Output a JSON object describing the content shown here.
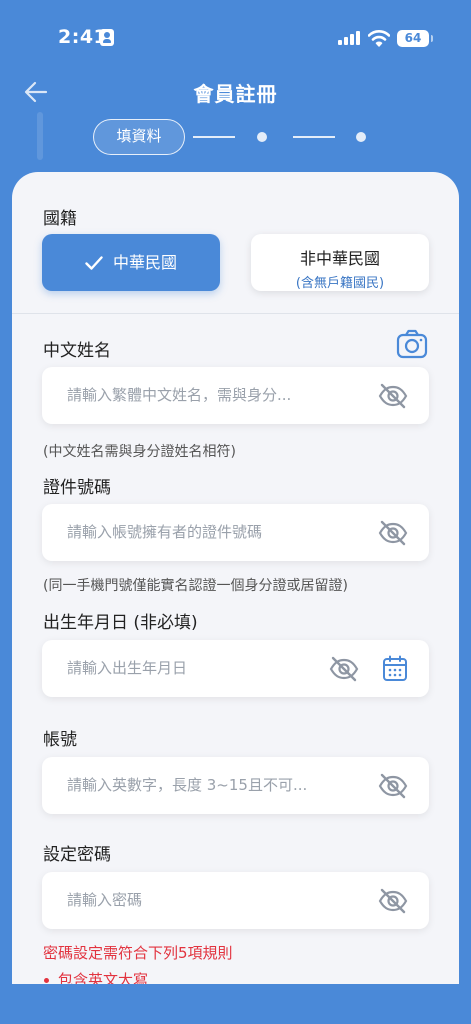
{
  "status_bar": {
    "time": "2:41",
    "battery": "64",
    "icons": [
      "contact-card-icon",
      "signal-icon",
      "wifi-icon",
      "battery-icon"
    ]
  },
  "header": {
    "title": "會員註冊",
    "back_icon": "arrow-left-icon"
  },
  "stepper": {
    "current_step_label": "填資料",
    "total_steps": 3,
    "current_step": 1
  },
  "nationality": {
    "label": "國籍",
    "options": [
      {
        "label": "中華民國",
        "selected": true
      },
      {
        "label": "非中華民國",
        "sublabel": "(含無戶籍國民)",
        "selected": false
      }
    ]
  },
  "chinese_name": {
    "label": "中文姓名",
    "placeholder": "請輸入繁體中文姓名，需與身分...",
    "hint": "(中文姓名需與身分證姓名相符)",
    "camera_icon": "camera-icon"
  },
  "id_number": {
    "label": "證件號碼",
    "placeholder": "請輸入帳號擁有者的證件號碼",
    "hint": "(同一手機門號僅能實名認證一個身分證或居留證)"
  },
  "birthday": {
    "label": "出生年月日 (非必填)",
    "placeholder": "請輸入出生年月日",
    "calendar_icon": "calendar-icon"
  },
  "account": {
    "label": "帳號",
    "placeholder": "請輸入英數字，長度 3~15且不可..."
  },
  "password": {
    "label": "設定密碼",
    "placeholder": "請輸入密碼",
    "rules_title": "密碼設定需符合下列5項規則",
    "rules": [
      "包含英文大寫"
    ]
  },
  "colors": {
    "primary": "#4a89d8",
    "background_card": "#f4f5f9",
    "error": "#e2333f",
    "link": "#3a76c4"
  }
}
